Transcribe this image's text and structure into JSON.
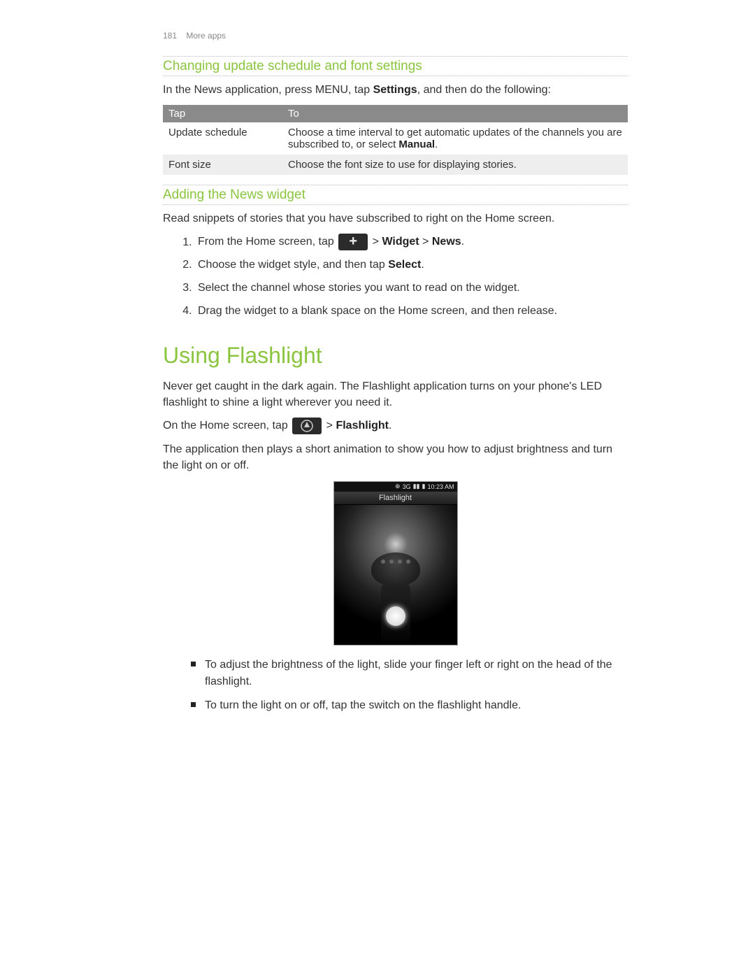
{
  "header": {
    "page_number": "181",
    "section": "More apps"
  },
  "section1": {
    "title": "Changing update schedule and font settings",
    "intro_pre": "In the News application, press MENU, tap ",
    "intro_bold": "Settings",
    "intro_post": ", and then do the following:",
    "table": {
      "head": {
        "c1": "Tap",
        "c2": "To"
      },
      "rows": [
        {
          "c1": "Update schedule",
          "c2_pre": "Choose a time interval to get automatic updates of the channels you are subscribed to, or select ",
          "c2_bold": "Manual",
          "c2_post": "."
        },
        {
          "c1": "Font size",
          "c2_pre": "Choose the font size to use for displaying stories.",
          "c2_bold": "",
          "c2_post": ""
        }
      ]
    }
  },
  "section2": {
    "title": "Adding the News widget",
    "intro": "Read snippets of stories that you have subscribed to right on the Home screen.",
    "steps": {
      "s1_pre": "From the Home screen, tap ",
      "s1_post_pre": " > ",
      "s1_bold1": "Widget",
      "s1_mid": " > ",
      "s1_bold2": "News",
      "s1_end": ".",
      "s2_pre": "Choose the widget style, and then tap ",
      "s2_bold": "Select",
      "s2_post": ".",
      "s3": "Select the channel whose stories you want to read on the widget.",
      "s4": "Drag the widget to a blank space on the Home screen, and then release."
    }
  },
  "section3": {
    "title": "Using Flashlight",
    "p1": "Never get caught in the dark again. The Flashlight application turns on your phone's LED flashlight to shine a light wherever you need it.",
    "p2_pre": "On the Home screen, tap ",
    "p2_post_pre": " > ",
    "p2_bold": "Flashlight",
    "p2_end": ".",
    "p3": "The application then plays a short animation to show you how to adjust brightness and turn the light on or off.",
    "phone": {
      "status_time": "10:23 AM",
      "status_net": "3G",
      "title": "Flashlight"
    },
    "bullets": {
      "b1": "To adjust the brightness of the light, slide your finger left or right on the head of the flashlight.",
      "b2": "To turn the light on or off, tap the switch on the flashlight handle."
    }
  }
}
